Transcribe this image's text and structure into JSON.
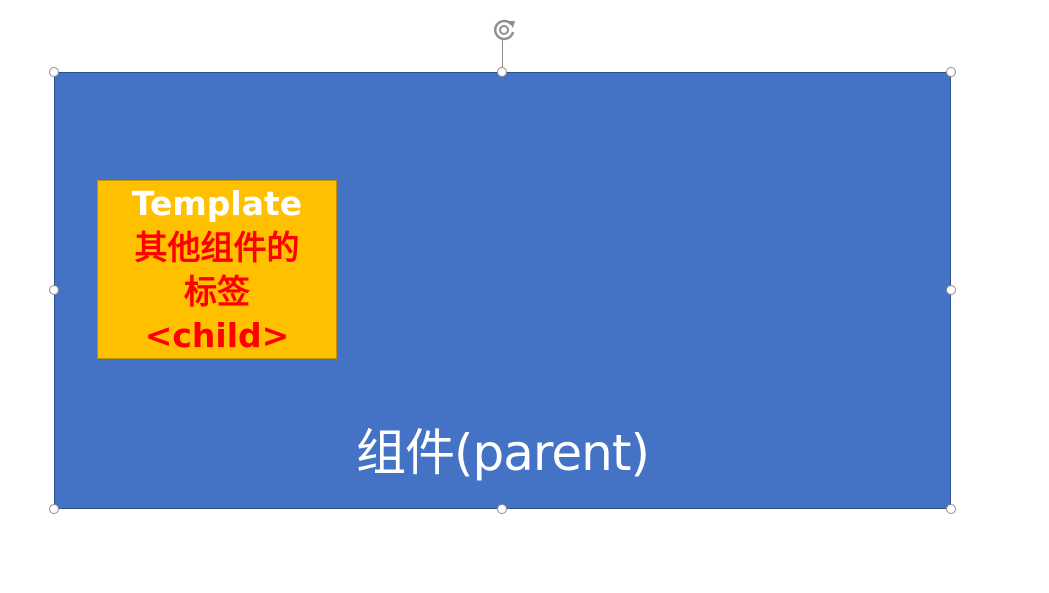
{
  "diagram": {
    "parent_label": "组件(parent)",
    "child_lines": [
      "Template",
      "其他组件的",
      "标签",
      "<child>"
    ],
    "colors": {
      "parent_fill": "#4472c4",
      "child_fill": "#ffc000",
      "child_title_text": "#ffffff",
      "child_body_text": "#ff0000",
      "parent_text": "#ffffff",
      "handle_stroke": "#8f8f8f"
    },
    "selection": {
      "rotate_icon": "rotate-handle-icon"
    }
  }
}
